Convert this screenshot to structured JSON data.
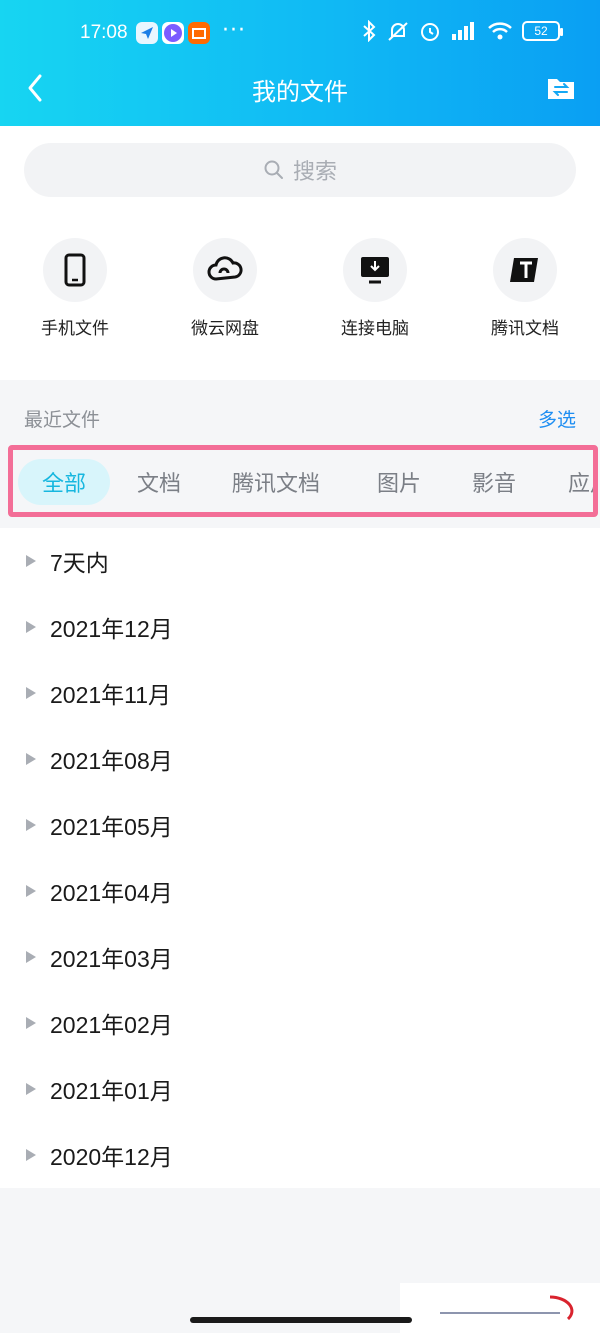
{
  "status_bar": {
    "time": "17:08",
    "dots": "···",
    "battery": "52"
  },
  "nav": {
    "title": "我的文件"
  },
  "search": {
    "placeholder": "搜索"
  },
  "shortcuts": [
    {
      "label": "手机文件",
      "icon": "phone-icon"
    },
    {
      "label": "微云网盘",
      "icon": "cloud-icon"
    },
    {
      "label": "连接电脑",
      "icon": "monitor-icon"
    },
    {
      "label": "腾讯文档",
      "icon": "tencent-docs-icon"
    }
  ],
  "recent": {
    "label": "最近文件",
    "multi_select": "多选"
  },
  "tabs": [
    {
      "label": "全部",
      "active": true
    },
    {
      "label": "文档",
      "active": false
    },
    {
      "label": "腾讯文档",
      "active": false
    },
    {
      "label": "图片",
      "active": false
    },
    {
      "label": "影音",
      "active": false
    },
    {
      "label": "应用",
      "active": false
    }
  ],
  "groups": [
    "7天内",
    "2021年12月",
    "2021年11月",
    "2021年08月",
    "2021年05月",
    "2021年04月",
    "2021年03月",
    "2021年02月",
    "2021年01月",
    "2020年12月"
  ],
  "colors": {
    "accent": "#1e8ef2",
    "active_tab": "#17b7df",
    "highlight_border": "#f36e97"
  }
}
